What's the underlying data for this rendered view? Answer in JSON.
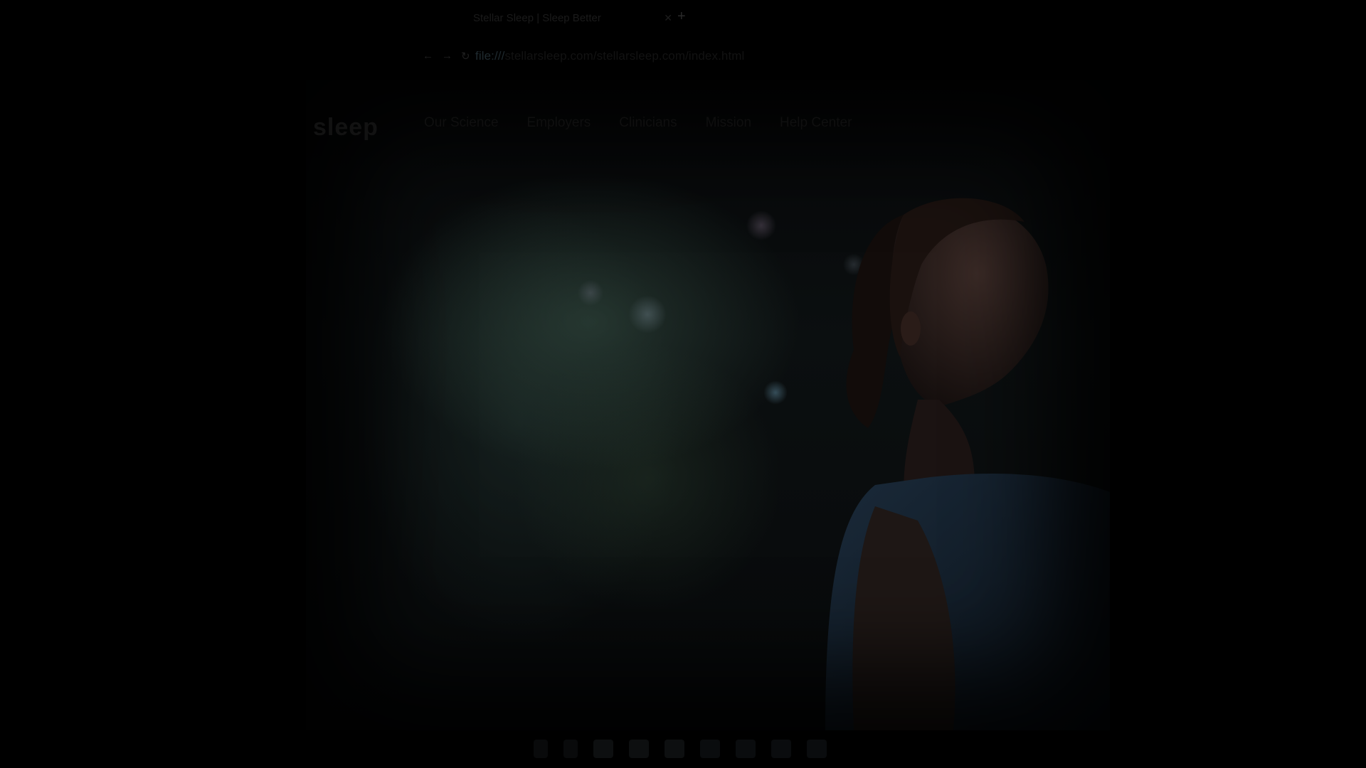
{
  "browser": {
    "tab_title": "Stellar Sleep | Sleep Better",
    "tab_close": "✕",
    "new_tab": "+",
    "nav_back": "←",
    "nav_forward": "→",
    "nav_reload": "↻",
    "url_prefix": "file:///",
    "url_host": "stellarsleep.com/stellarsleep.com/index.html"
  },
  "site": {
    "logo": "sleep",
    "nav": [
      "Our Science",
      "Employers",
      "Clinicians",
      "Mission",
      "Help Center"
    ]
  },
  "taskbar": {
    "icons": [
      "chevron-up-icon",
      "bell-icon",
      "monitor-icon",
      "folder-icon",
      "calendar-icon",
      "settings-icon",
      "chat-icon",
      "terminal-icon",
      "help-icon"
    ]
  }
}
